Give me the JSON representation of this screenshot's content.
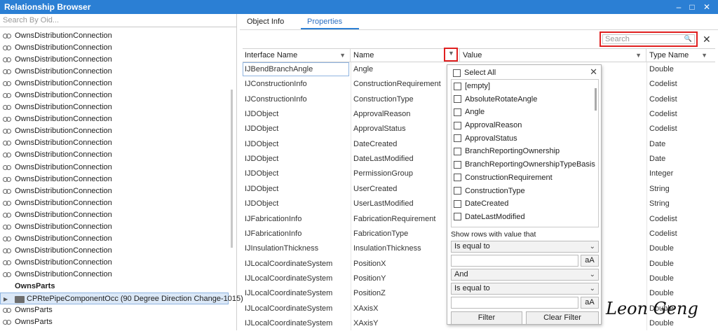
{
  "window": {
    "title": "Relationship Browser",
    "min": "–",
    "max": "□",
    "close": "✕"
  },
  "left": {
    "search_placeholder": "Search By Oid...",
    "items": [
      "OwnsDistributionConnection",
      "OwnsDistributionConnection",
      "OwnsDistributionConnection",
      "OwnsDistributionConnection",
      "OwnsDistributionConnection",
      "OwnsDistributionConnection",
      "OwnsDistributionConnection",
      "OwnsDistributionConnection",
      "OwnsDistributionConnection",
      "OwnsDistributionConnection",
      "OwnsDistributionConnection",
      "OwnsDistributionConnection",
      "OwnsDistributionConnection",
      "OwnsDistributionConnection",
      "OwnsDistributionConnection",
      "OwnsDistributionConnection",
      "OwnsDistributionConnection",
      "OwnsDistributionConnection",
      "OwnsDistributionConnection",
      "OwnsDistributionConnection",
      "OwnsDistributionConnection"
    ],
    "owns_parts_bold": "OwnsParts",
    "selected_node": "CPRtePipeComponentOcc (90 Degree Direction Change-1015)",
    "owns_parts_2": "OwnsParts",
    "owns_parts_3": "OwnsParts"
  },
  "tabs": {
    "object_info": "Object Info",
    "properties": "Properties"
  },
  "search": {
    "placeholder": "Search",
    "icon": "search-icon"
  },
  "grid": {
    "headers": [
      "Interface Name",
      "Name",
      "Value",
      "Type Name"
    ],
    "rows": [
      [
        "IJBendBranchAngle",
        "Angle",
        "Double"
      ],
      [
        "IJConstructionInfo",
        "ConstructionRequirement",
        "Codelist"
      ],
      [
        "IJConstructionInfo",
        "ConstructionType",
        "Codelist"
      ],
      [
        "IJDObject",
        "ApprovalReason",
        "Codelist"
      ],
      [
        "IJDObject",
        "ApprovalStatus",
        "Codelist"
      ],
      [
        "IJDObject",
        "DateCreated",
        "Date"
      ],
      [
        "IJDObject",
        "DateLastModified",
        "Date"
      ],
      [
        "IJDObject",
        "PermissionGroup",
        "Integer"
      ],
      [
        "IJDObject",
        "UserCreated",
        "String"
      ],
      [
        "IJDObject",
        "UserLastModified",
        "String"
      ],
      [
        "IJFabricationInfo",
        "FabricationRequirement",
        "Codelist"
      ],
      [
        "IJFabricationInfo",
        "FabricationType",
        "Codelist"
      ],
      [
        "IJInsulationThickness",
        "InsulationThickness",
        "Double"
      ],
      [
        "IJLocalCoordinateSystem",
        "PositionX",
        "Double"
      ],
      [
        "IJLocalCoordinateSystem",
        "PositionY",
        "Double"
      ],
      [
        "IJLocalCoordinateSystem",
        "PositionZ",
        "Double"
      ],
      [
        "IJLocalCoordinateSystem",
        "XAxisX",
        "Double"
      ],
      [
        "IJLocalCoordinateSystem",
        "XAxisY",
        "Double"
      ]
    ]
  },
  "filter_popup": {
    "select_all": "Select All",
    "items": [
      "[empty]",
      "AbsoluteRotateAngle",
      "Angle",
      "ApprovalReason",
      "ApprovalStatus",
      "BranchReportingOwnership",
      "BranchReportingOwnershipTypeBasis",
      "ConstructionRequirement",
      "ConstructionType",
      "DateCreated",
      "DateLastModified"
    ],
    "show_rows_label": "Show rows with value that",
    "op1": "Is equal to",
    "aa": "aA",
    "logic": "And",
    "op2": "Is equal to",
    "filter_btn": "Filter",
    "clear_btn": "Clear Filter"
  },
  "watermark": "Leon Geng",
  "colors": {
    "titlebar": "#2b7fd4",
    "highlight": "#e02020",
    "tab_active": "#2b6fc2"
  }
}
